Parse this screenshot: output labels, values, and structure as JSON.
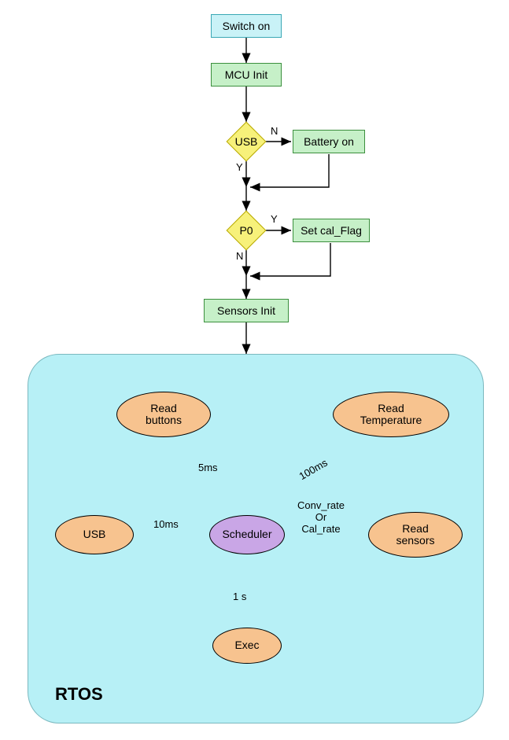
{
  "nodes": {
    "switch_on": "Switch on",
    "mcu_init": "MCU Init",
    "usb": "USB",
    "battery_on": "Battery on",
    "p0": "P0",
    "set_cal_flag": "Set cal_Flag",
    "sensors_init": "Sensors Init"
  },
  "branch": {
    "usb_no": "N",
    "usb_yes": "Y",
    "p0_yes": "Y",
    "p0_no": "N"
  },
  "rtos": {
    "title": "RTOS",
    "scheduler": "Scheduler",
    "read_buttons": "Read\nbuttons",
    "read_temp": "Read\nTemperature",
    "usb": "USB",
    "read_sensors": "Read\nsensors",
    "exec": "Exec"
  },
  "timings": {
    "buttons": "5ms",
    "temp": "100ms",
    "usb": "10ms",
    "sensors": "Conv_rate\nOr\nCal_rate",
    "exec": "1 s"
  }
}
